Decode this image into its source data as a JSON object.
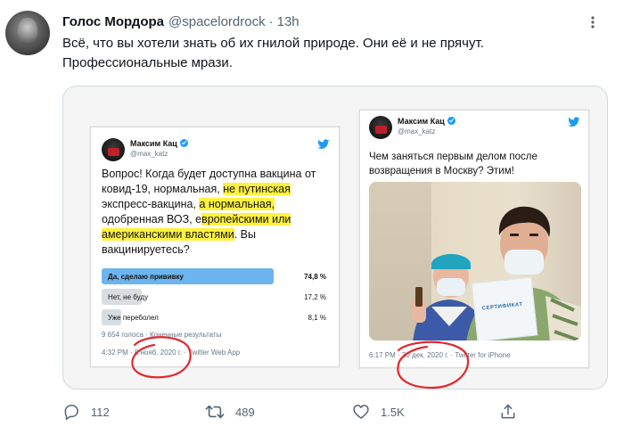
{
  "tweet": {
    "display_name": "Голос Мордора",
    "handle": "@spacelordrock",
    "separator": "·",
    "time": "13h",
    "text": "Всё, что вы хотели знать об их гнилой природе. Они её и не прячут. Профессиональные мрази."
  },
  "card1": {
    "name": "Максим Кац",
    "handle": "@max_katz",
    "text_parts": {
      "p1": "Вопрос! Когда будет доступна вакцина от ковид-19, нормальная, ",
      "h1": "не путинская",
      "p2": " экспресс-вакцина, ",
      "h2": "а нормальная,",
      "p3": " одобренная ВОЗ, е",
      "h3": "вропейскими или американскими властями",
      "p4": ". Вы вакцинируетесь?"
    },
    "poll": [
      {
        "label": "Да, сделаю прививку",
        "percent": "74,8 %",
        "fraction": 0.748
      },
      {
        "label": "Нет, не буду",
        "percent": "17,2 %",
        "fraction": 0.172
      },
      {
        "label": "Уже переболел",
        "percent": "8,1 %",
        "fraction": 0.081
      }
    ],
    "results": "9 654 голоса · Конечные результаты",
    "meta_time": "4:32 PM · ",
    "meta_date": "8 нояб. 2020 г.",
    "meta_source": " · Twitter Web App"
  },
  "card2": {
    "name": "Максим Кац",
    "handle": "@max_katz",
    "text": "Чем заняться первым делом после возвращения в Москву? Этим!",
    "certificate": "СЕРТИФИКАТ",
    "meta_time": "6:17 PM · ",
    "meta_date": "30 дек. 2020 г.",
    "meta_source": " · Twitter for iPhone"
  },
  "actions": {
    "reply_count": "112",
    "retweet_count": "489",
    "like_count": "1.5K"
  },
  "colors": {
    "highlight": "#fff23d",
    "poll_winner": "#6cb4ee",
    "poll_other": "#d8dde1",
    "annotation": "#e2282e",
    "verified": "#1d9bf0"
  },
  "icons": [
    "more-icon",
    "reply-icon",
    "retweet-icon",
    "like-icon",
    "share-icon",
    "verified-icon",
    "twitter-logo-icon"
  ]
}
